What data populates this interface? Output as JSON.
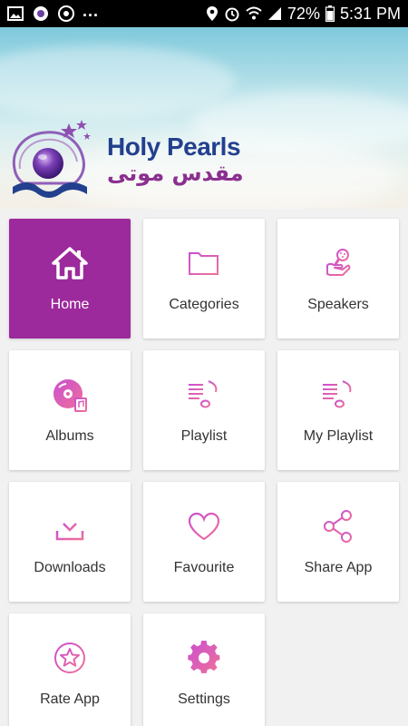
{
  "status_bar": {
    "left_icons": [
      "gallery-icon",
      "camera-app-icon",
      "chrome-icon"
    ],
    "overflow": "...",
    "right_icons": [
      "location-icon",
      "alarm-icon",
      "wifi-icon",
      "signal-icon"
    ],
    "battery_percent": "72%",
    "time": "5:31 PM"
  },
  "banner": {
    "brand_name": "Holy Pearls",
    "brand_name_arabic": "مقدس موتی"
  },
  "menu": [
    {
      "label": "Home",
      "icon": "home-icon",
      "active": true
    },
    {
      "label": "Categories",
      "icon": "folder-icon",
      "active": false
    },
    {
      "label": "Speakers",
      "icon": "microphone-icon",
      "active": false
    },
    {
      "label": "Albums",
      "icon": "album-disc-icon",
      "active": false
    },
    {
      "label": "Playlist",
      "icon": "playlist-icon",
      "active": false
    },
    {
      "label": "My Playlist",
      "icon": "my-playlist-icon",
      "active": false
    },
    {
      "label": "Downloads",
      "icon": "download-icon",
      "active": false
    },
    {
      "label": "Favourite",
      "icon": "heart-icon",
      "active": false
    },
    {
      "label": "Share App",
      "icon": "share-icon",
      "active": false
    },
    {
      "label": "Rate App",
      "icon": "star-badge-icon",
      "active": false
    },
    {
      "label": "Settings",
      "icon": "gear-icon",
      "active": false
    }
  ],
  "colors": {
    "accent": "#9c2a9c",
    "icon_gradient_start": "#c94fd0",
    "icon_gradient_end": "#f0709a",
    "brand_blue": "#23408e"
  }
}
